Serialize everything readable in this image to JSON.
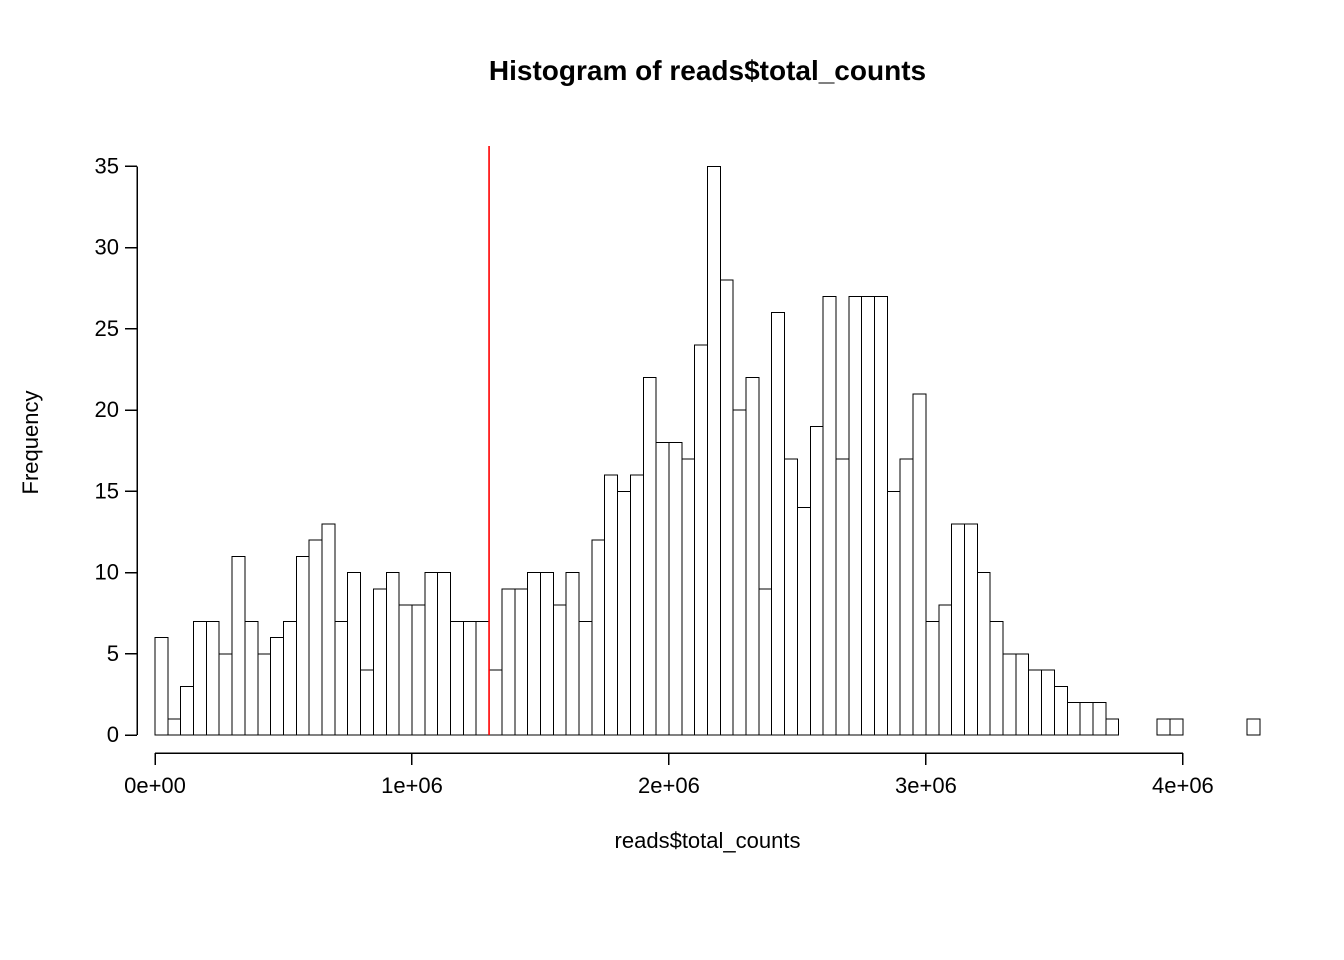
{
  "chart_data": {
    "type": "bar",
    "title": "Histogram of reads$total_counts",
    "xlabel": "reads$total_counts",
    "ylabel": "Frequency",
    "bin_width": 50000,
    "x_ticks": [
      0,
      1000000,
      2000000,
      3000000,
      4000000
    ],
    "x_tick_labels": [
      "0e+00",
      "1e+06",
      "2e+06",
      "3e+06",
      "4e+06"
    ],
    "y_ticks": [
      0,
      5,
      10,
      15,
      20,
      25,
      30,
      35
    ],
    "x_range": [
      0,
      4300000
    ],
    "y_range": [
      0,
      36
    ],
    "vline_x": 1300000,
    "vline_color": "#ff0000",
    "bar_fill": "#ffffff",
    "bar_stroke": "#000000",
    "bins": [
      {
        "x": 0,
        "f": 6
      },
      {
        "x": 50000,
        "f": 1
      },
      {
        "x": 100000,
        "f": 3
      },
      {
        "x": 150000,
        "f": 7
      },
      {
        "x": 200000,
        "f": 7
      },
      {
        "x": 250000,
        "f": 5
      },
      {
        "x": 300000,
        "f": 11
      },
      {
        "x": 350000,
        "f": 7
      },
      {
        "x": 400000,
        "f": 5
      },
      {
        "x": 450000,
        "f": 6
      },
      {
        "x": 500000,
        "f": 7
      },
      {
        "x": 550000,
        "f": 11
      },
      {
        "x": 600000,
        "f": 12
      },
      {
        "x": 650000,
        "f": 13
      },
      {
        "x": 700000,
        "f": 7
      },
      {
        "x": 750000,
        "f": 10
      },
      {
        "x": 800000,
        "f": 4
      },
      {
        "x": 850000,
        "f": 9
      },
      {
        "x": 900000,
        "f": 10
      },
      {
        "x": 950000,
        "f": 8
      },
      {
        "x": 1000000,
        "f": 8
      },
      {
        "x": 1050000,
        "f": 10
      },
      {
        "x": 1100000,
        "f": 10
      },
      {
        "x": 1150000,
        "f": 7
      },
      {
        "x": 1200000,
        "f": 7
      },
      {
        "x": 1250000,
        "f": 7
      },
      {
        "x": 1300000,
        "f": 4
      },
      {
        "x": 1350000,
        "f": 9
      },
      {
        "x": 1400000,
        "f": 9
      },
      {
        "x": 1450000,
        "f": 10
      },
      {
        "x": 1500000,
        "f": 10
      },
      {
        "x": 1550000,
        "f": 8
      },
      {
        "x": 1600000,
        "f": 10
      },
      {
        "x": 1650000,
        "f": 7
      },
      {
        "x": 1700000,
        "f": 12
      },
      {
        "x": 1750000,
        "f": 16
      },
      {
        "x": 1800000,
        "f": 15
      },
      {
        "x": 1850000,
        "f": 16
      },
      {
        "x": 1900000,
        "f": 22
      },
      {
        "x": 1950000,
        "f": 18
      },
      {
        "x": 2000000,
        "f": 18
      },
      {
        "x": 2050000,
        "f": 17
      },
      {
        "x": 2100000,
        "f": 24
      },
      {
        "x": 2150000,
        "f": 35
      },
      {
        "x": 2200000,
        "f": 28
      },
      {
        "x": 2250000,
        "f": 20
      },
      {
        "x": 2300000,
        "f": 22
      },
      {
        "x": 2350000,
        "f": 9
      },
      {
        "x": 2400000,
        "f": 26
      },
      {
        "x": 2450000,
        "f": 17
      },
      {
        "x": 2500000,
        "f": 14
      },
      {
        "x": 2550000,
        "f": 19
      },
      {
        "x": 2600000,
        "f": 27
      },
      {
        "x": 2650000,
        "f": 17
      },
      {
        "x": 2700000,
        "f": 27
      },
      {
        "x": 2750000,
        "f": 27
      },
      {
        "x": 2800000,
        "f": 27
      },
      {
        "x": 2850000,
        "f": 15
      },
      {
        "x": 2900000,
        "f": 17
      },
      {
        "x": 2950000,
        "f": 21
      },
      {
        "x": 3000000,
        "f": 7
      },
      {
        "x": 3050000,
        "f": 8
      },
      {
        "x": 3100000,
        "f": 13
      },
      {
        "x": 3150000,
        "f": 13
      },
      {
        "x": 3200000,
        "f": 10
      },
      {
        "x": 3250000,
        "f": 7
      },
      {
        "x": 3300000,
        "f": 5
      },
      {
        "x": 3350000,
        "f": 5
      },
      {
        "x": 3400000,
        "f": 4
      },
      {
        "x": 3450000,
        "f": 4
      },
      {
        "x": 3500000,
        "f": 3
      },
      {
        "x": 3550000,
        "f": 2
      },
      {
        "x": 3600000,
        "f": 2
      },
      {
        "x": 3650000,
        "f": 2
      },
      {
        "x": 3700000,
        "f": 1
      },
      {
        "x": 3900000,
        "f": 1
      },
      {
        "x": 3950000,
        "f": 1
      },
      {
        "x": 4250000,
        "f": 1
      }
    ]
  },
  "fonts": {
    "title_size": 28,
    "axis_label_size": 22,
    "tick_label_size": 22
  }
}
